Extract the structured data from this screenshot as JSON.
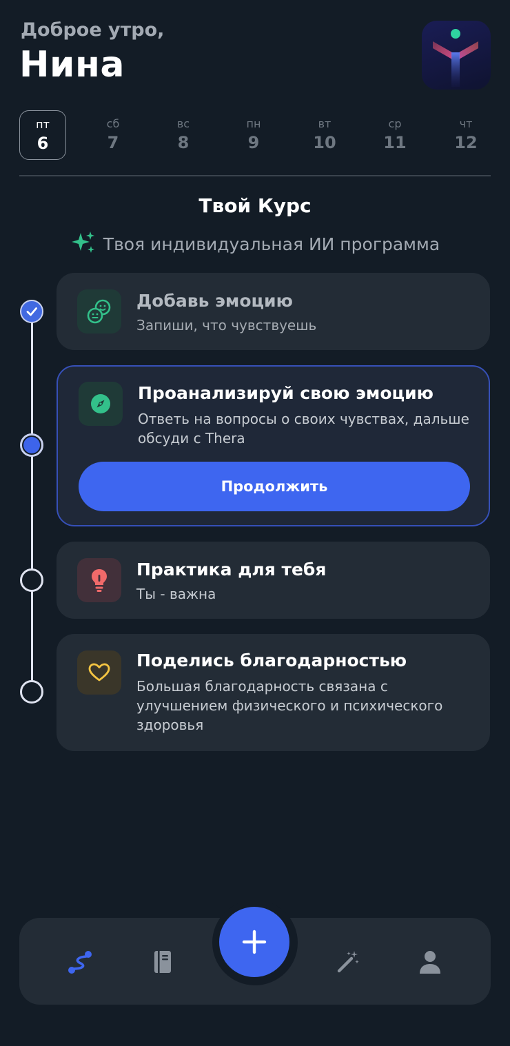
{
  "header": {
    "greeting": "Доброе утро,",
    "user_name": "Нина",
    "logo_icon": "app-logo-icon"
  },
  "date_strip": {
    "days": [
      {
        "name": "пт",
        "num": "6",
        "selected": true
      },
      {
        "name": "сб",
        "num": "7",
        "selected": false
      },
      {
        "name": "вс",
        "num": "8",
        "selected": false
      },
      {
        "name": "пн",
        "num": "9",
        "selected": false
      },
      {
        "name": "вт",
        "num": "10",
        "selected": false
      },
      {
        "name": "ср",
        "num": "11",
        "selected": false
      },
      {
        "name": "чт",
        "num": "12",
        "selected": false
      }
    ]
  },
  "course": {
    "title": "Твой Курс",
    "subtitle": "Твоя индивидуальная ИИ программа",
    "subtitle_icon": "sparkles-icon"
  },
  "steps": [
    {
      "title": "Добавь эмоцию",
      "description": "Запиши, что чувствуешь",
      "status": "completed",
      "icon": "emotion-faces-icon"
    },
    {
      "title": "Проанализируй свою эмоцию",
      "description": "Ответь на вопросы о своих чувствах, дальше обсуди с Thera",
      "status": "active",
      "icon": "compass-icon",
      "button_label": "Продолжить"
    },
    {
      "title": "Практика для тебя",
      "description": "Ты - важна",
      "status": "upcoming",
      "icon": "lightbulb-icon"
    },
    {
      "title": "Поделись благодарностью",
      "description": "Большая благодарность связана с улучшением физического и психического здоровья",
      "status": "upcoming",
      "icon": "heart-icon"
    }
  ],
  "bottom_nav": {
    "items": [
      "course-path-icon",
      "journal-icon",
      "add-icon",
      "magic-wand-icon",
      "profile-icon"
    ],
    "active": "course-path-icon"
  },
  "colors": {
    "background": "#131c26",
    "card": "#232c36",
    "accent": "#3e66f0",
    "green": "#33c08a",
    "red": "#f06a6a",
    "yellow": "#f5c542"
  }
}
